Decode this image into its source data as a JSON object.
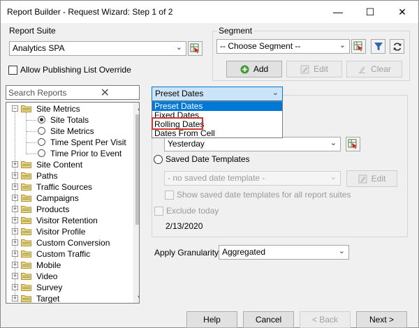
{
  "window": {
    "title": "Report Builder - Request Wizard: Step 1 of 2",
    "minimize_glyph": "—",
    "maximize_glyph": "☐",
    "close_glyph": "✕"
  },
  "report_suite": {
    "group_label": "Report Suite",
    "value": "Analytics SPA",
    "allow_publishing_label": "Allow Publishing List Override"
  },
  "segment": {
    "group_label": "Segment",
    "value": "-- Choose Segment --",
    "add_label": "Add",
    "edit_label": "Edit",
    "clear_label": "Clear"
  },
  "search": {
    "placeholder": "Search Reports",
    "clear_glyph": "✕"
  },
  "tree": {
    "root": "Site Metrics",
    "children": [
      "Site Totals",
      "Site Metrics",
      "Time Spent Per Visit",
      "Time Prior to Event"
    ],
    "selected_child": "Site Totals",
    "folders": [
      "Site Content",
      "Paths",
      "Traffic Sources",
      "Campaigns",
      "Products",
      "Visitor Retention",
      "Visitor Profile",
      "Custom Conversion",
      "Custom Traffic",
      "Mobile",
      "Video",
      "Survey",
      "Target"
    ]
  },
  "date": {
    "type_value": "Preset Dates",
    "options": [
      "Preset Dates",
      "Fixed Dates",
      "Rolling Dates",
      "Dates From Cell"
    ],
    "selected_option": "Preset Dates",
    "highlighted_option": "Rolling Dates",
    "preset_value": "Yesterday",
    "saved_templates_label": "Saved Date Templates",
    "template_value": "- no saved date template -",
    "template_edit_label": "Edit",
    "show_saved_label": "Show saved date templates for all report suites",
    "exclude_today_label": "Exclude today",
    "date_value": "2/13/2020"
  },
  "granularity": {
    "label": "Apply Granularity",
    "value": "Aggregated"
  },
  "footer": {
    "help_label": "Help",
    "cancel_label": "Cancel",
    "back_label": "< Back",
    "next_label": "Next >"
  },
  "colors": {
    "selection": "#0078d7",
    "highlight": "#d0342c",
    "window_bg": "#f0f0f0"
  }
}
